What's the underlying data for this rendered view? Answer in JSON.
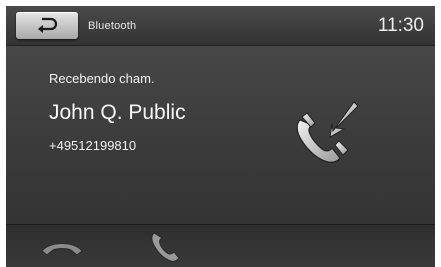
{
  "header": {
    "title": "Bluetooth",
    "time": "11:30",
    "back_icon": "back-arrow-icon"
  },
  "call": {
    "status": "Recebendo cham.",
    "caller_name": "John Q. Public",
    "caller_number": "+49512199810",
    "status_icon": "incoming-call-icon"
  },
  "softkeys": {
    "reject_icon": "hang-up-icon",
    "accept_icon": "phone-icon"
  },
  "colors": {
    "background": "#3a3a3a",
    "text": "#f2f2f2",
    "button": "#c8c8c8"
  }
}
